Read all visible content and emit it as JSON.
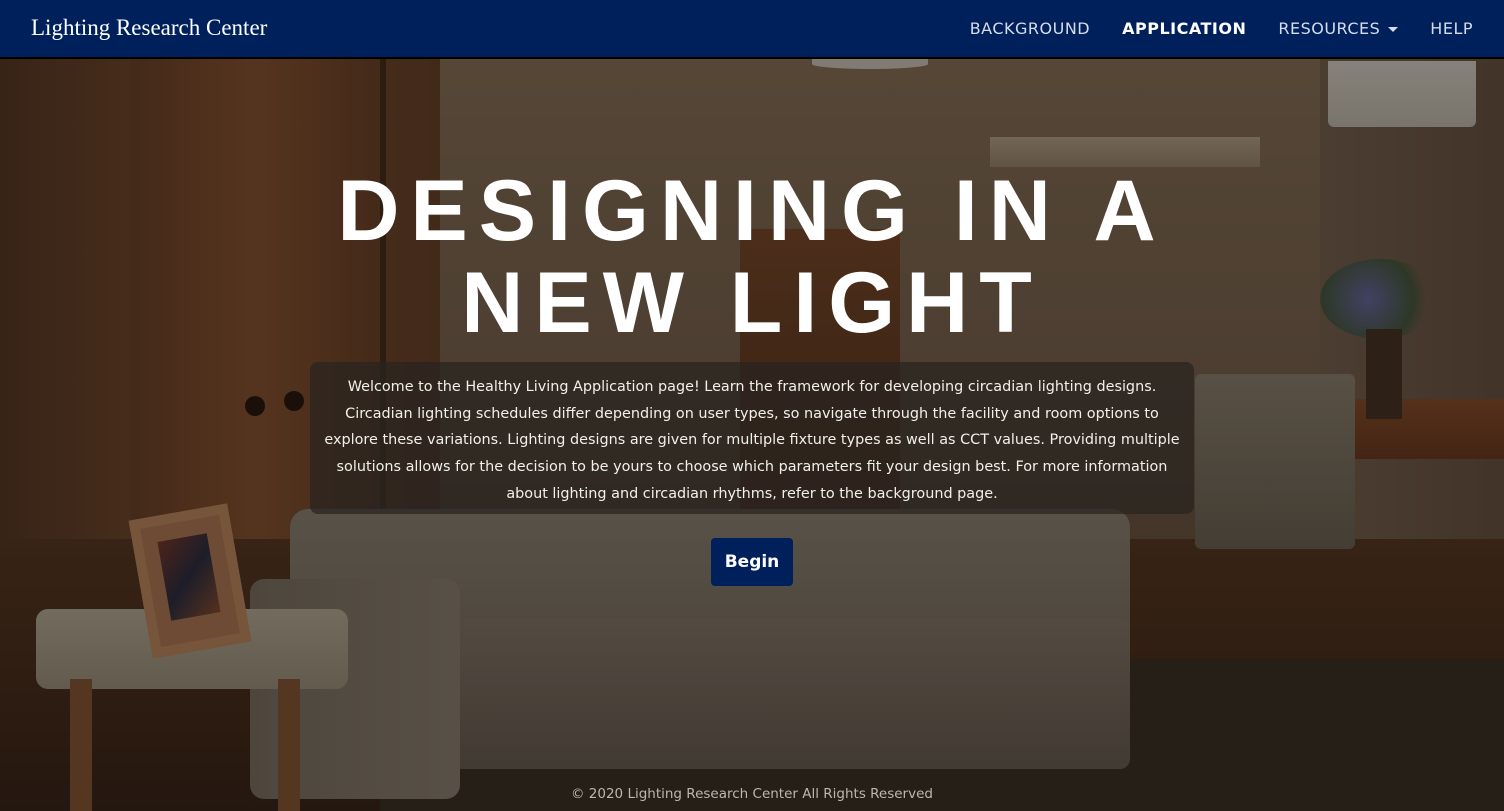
{
  "navbar": {
    "brand": "Lighting Research Center",
    "links": [
      {
        "label": "BACKGROUND",
        "active": false
      },
      {
        "label": "APPLICATION",
        "active": true
      },
      {
        "label": "RESOURCES",
        "active": false,
        "dropdown": true
      },
      {
        "label": "HELP",
        "active": false
      }
    ],
    "background_color": "#00205b"
  },
  "hero": {
    "title_line1": "DESIGNING IN A",
    "title_line2": "NEW LIGHT",
    "intro": "Welcome to the Healthy Living Application page! Learn the framework for developing circadian lighting designs. Circadian lighting schedules differ depending on user types, so navigate through the facility and room options to explore these variations. Lighting designs are given for multiple fixture types as well as CCT values. Providing multiple solutions allows for the decision to be yours to choose which parameters fit your design best. For more information about lighting and circadian rhythms, refer to the background page.",
    "begin_label": "Begin",
    "button_color": "#00205b"
  },
  "footer": {
    "copyright": "© 2020 Lighting Research Center All Rights Reserved"
  },
  "icons": {
    "resources_dropdown": "caret-down-icon"
  }
}
